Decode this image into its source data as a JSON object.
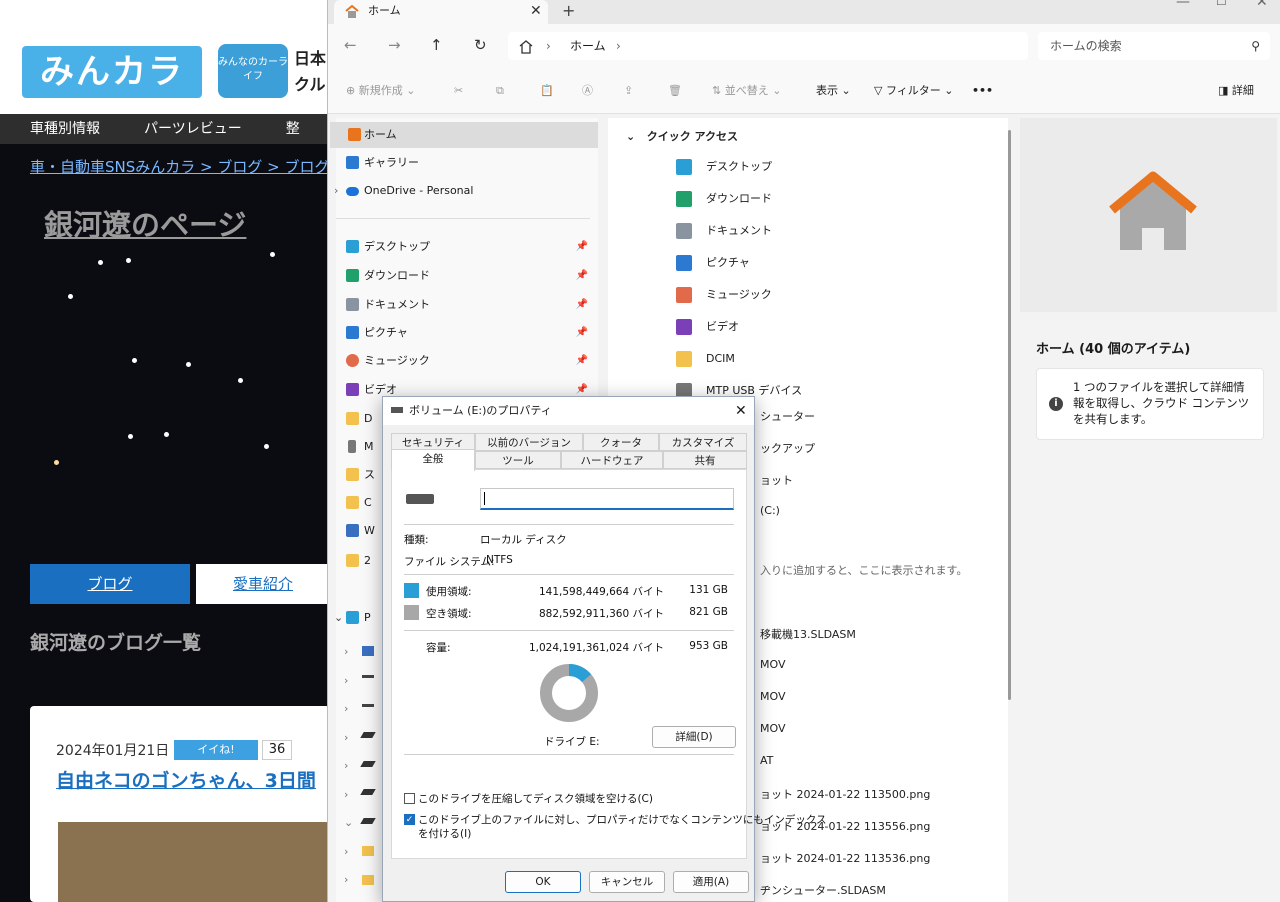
{
  "web": {
    "logo": "みんカラ",
    "logo_sub": "みんなのカーライフ",
    "header_text_1": "日本",
    "header_text_2": "クル",
    "nav": [
      "車種別情報",
      "パーツレビュー",
      "整"
    ],
    "breadcrumb": "車・自動車SNSみんカラ > ブログ > ブログ一",
    "page_title": "銀河遼のページ",
    "tab_blog": "ブログ",
    "tab_car": "愛車紹介",
    "list_heading": "銀河遼のブログ一覧",
    "post_date": "2024年01月21日",
    "iine": "イイね!",
    "iine_count": "36",
    "post_title": "自由ネコのゴンちゃん、3日間"
  },
  "explorer": {
    "tab_title": "ホーム",
    "address_segment": "ホーム",
    "search_placeholder": "ホームの検索",
    "toolbar": {
      "new": "新規作成",
      "sort": "並べ替え",
      "view": "表示",
      "filter": "フィルター",
      "more": "•••",
      "details": "詳細"
    },
    "nav": {
      "home": "ホーム",
      "gallery": "ギャラリー",
      "onedrive": "OneDrive - Personal",
      "desktop": "デスクトップ",
      "downloads": "ダウンロード",
      "documents": "ドキュメント",
      "pictures": "ピクチャ",
      "music": "ミュージック",
      "videos": "ビデオ",
      "partial": [
        "D",
        "M",
        "ス",
        "C",
        "W",
        "2",
        "P"
      ]
    },
    "quick_access_label": "クイック アクセス",
    "quick_access": [
      {
        "label": "デスクトップ",
        "color": "#2a9fd6"
      },
      {
        "label": "ダウンロード",
        "color": "#22a06b"
      },
      {
        "label": "ドキュメント",
        "color": "#8a93a0"
      },
      {
        "label": "ピクチャ",
        "color": "#2b79d0"
      },
      {
        "label": "ミュージック",
        "color": "#e06a4a"
      },
      {
        "label": "ビデオ",
        "color": "#7b3fb8"
      },
      {
        "label": "DCIM",
        "color": "#f2c14e"
      },
      {
        "label": "MTP USB デバイス",
        "color": "#777777"
      }
    ],
    "partial_items": [
      "シューター",
      "ックアップ",
      "ョット",
      "(C:)"
    ],
    "favorites_hint": "入りに追加すると、ここに表示されます。",
    "recent_partial": [
      "移載機13.SLDASM",
      "MOV",
      "MOV",
      "MOV",
      "AT",
      "ョット 2024-01-22 113500.png",
      "ョット 2024-01-22 113556.png",
      "ョット 2024-01-22 113536.png",
      "ヂンシューター.SLDASM"
    ],
    "detail_title": "ホーム (40 個のアイテム)",
    "detail_info": "1 つのファイルを選択して詳細情報を取得し、クラウド コンテンツを共有します。"
  },
  "dialog": {
    "title": "ボリューム (E:)のプロパティ",
    "tabs_row1": [
      "セキュリティ",
      "以前のバージョン",
      "クォータ",
      "カスタマイズ"
    ],
    "tabs_row2": [
      "全般",
      "ツール",
      "ハードウェア",
      "共有"
    ],
    "name_value": "",
    "type_label": "種類:",
    "type_value": "ローカル ディスク",
    "fs_label": "ファイル システム:",
    "fs_value": "NTFS",
    "used_label": "使用領域:",
    "used_bytes": "141,598,449,664 バイト",
    "used_gb": "131 GB",
    "free_label": "空き領域:",
    "free_bytes": "882,592,911,360 バイト",
    "free_gb": "821 GB",
    "cap_label": "容量:",
    "cap_bytes": "1,024,191,361,024 バイト",
    "cap_gb": "953 GB",
    "used_fraction": 0.138,
    "used_color": "#2a9fd6",
    "free_color": "#a8a8a8",
    "drive_label": "ドライブ E:",
    "details_button": "詳細(D)",
    "compress_label": "このドライブを圧縮してディスク領域を空ける(C)",
    "compress_checked": false,
    "index_label_1": "このドライブ上のファイルに対し、プロパティだけでなくコンテンツにもインデックス",
    "index_label_2": "を付ける(I)",
    "index_checked": true,
    "ok": "OK",
    "cancel": "キャンセル",
    "apply": "適用(A)"
  }
}
